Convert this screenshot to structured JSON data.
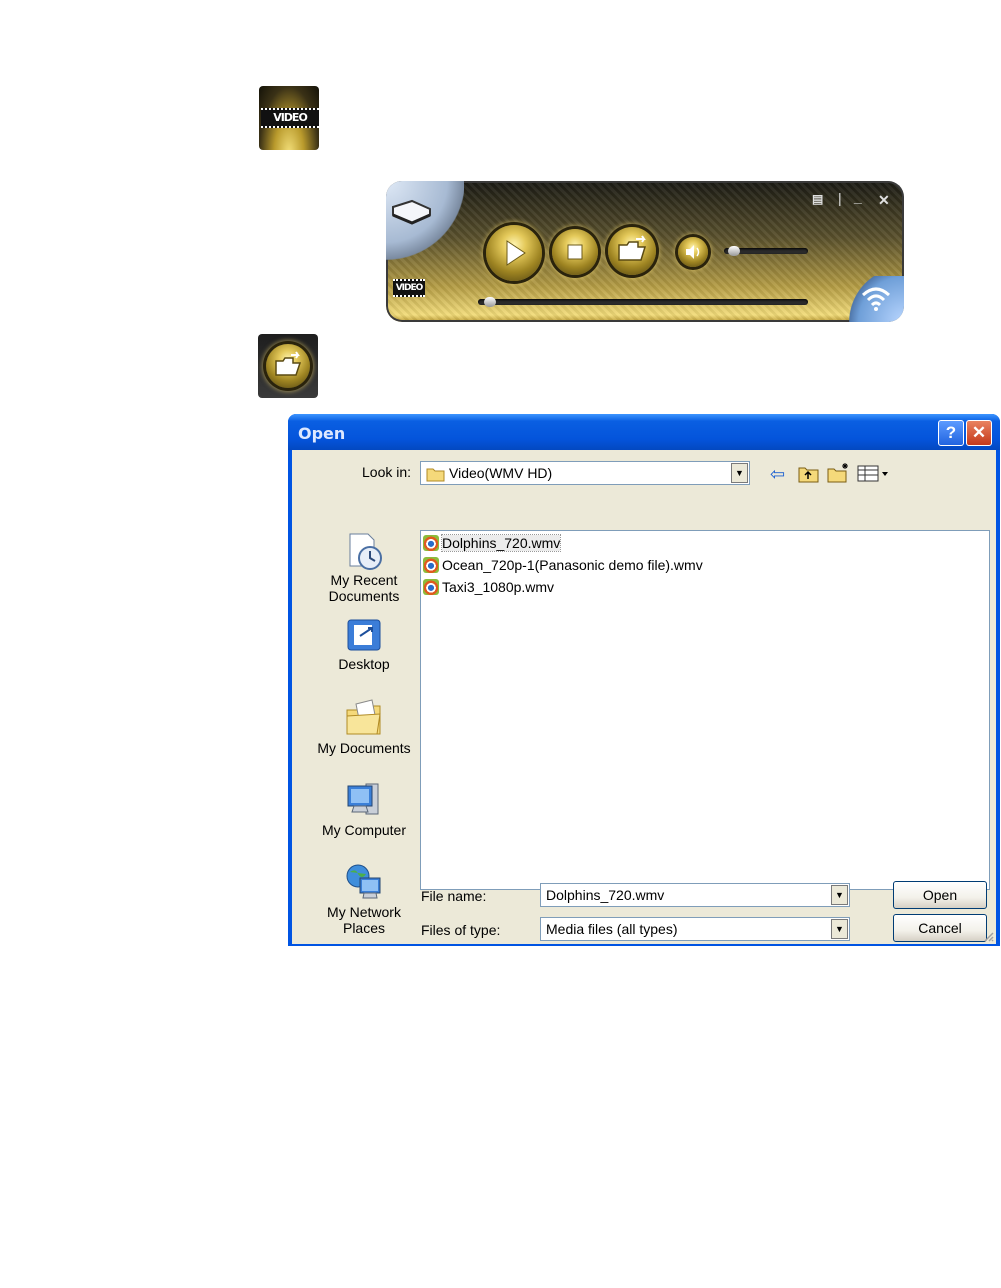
{
  "video_tile": {
    "tag": "VIDEO"
  },
  "player": {
    "video_tag": "VIDEO",
    "window_controls": {
      "menu": "▤",
      "separator": "|",
      "minimize": "_",
      "close": "✕"
    },
    "volume_level": 0.05,
    "seek_position": 0.02,
    "icons": [
      "projector-icon",
      "play-icon",
      "stop-icon",
      "open-folder-icon",
      "speaker-icon",
      "wifi-icon"
    ]
  },
  "dialog": {
    "title": "Open",
    "help": "?",
    "close": "✕",
    "look_in_label": "Look in:",
    "look_in_value": "Video(WMV HD)",
    "places": [
      {
        "label_line1": "My Recent",
        "label_line2": "Documents"
      },
      {
        "label_line1": "Desktop",
        "label_line2": ""
      },
      {
        "label_line1": "My Documents",
        "label_line2": ""
      },
      {
        "label_line1": "My Computer",
        "label_line2": ""
      },
      {
        "label_line1": "My Network",
        "label_line2": "Places"
      }
    ],
    "files": [
      {
        "name": "Dolphins_720.wmv",
        "selected": true
      },
      {
        "name": "Ocean_720p-1(Panasonic demo file).wmv",
        "selected": false
      },
      {
        "name": "Taxi3_1080p.wmv",
        "selected": false
      }
    ],
    "file_name_label": "File name:",
    "file_name_value": "Dolphins_720.wmv",
    "file_type_label": "Files of type:",
    "file_type_value": "Media files (all types)",
    "open_button": "Open",
    "cancel_button": "Cancel"
  }
}
